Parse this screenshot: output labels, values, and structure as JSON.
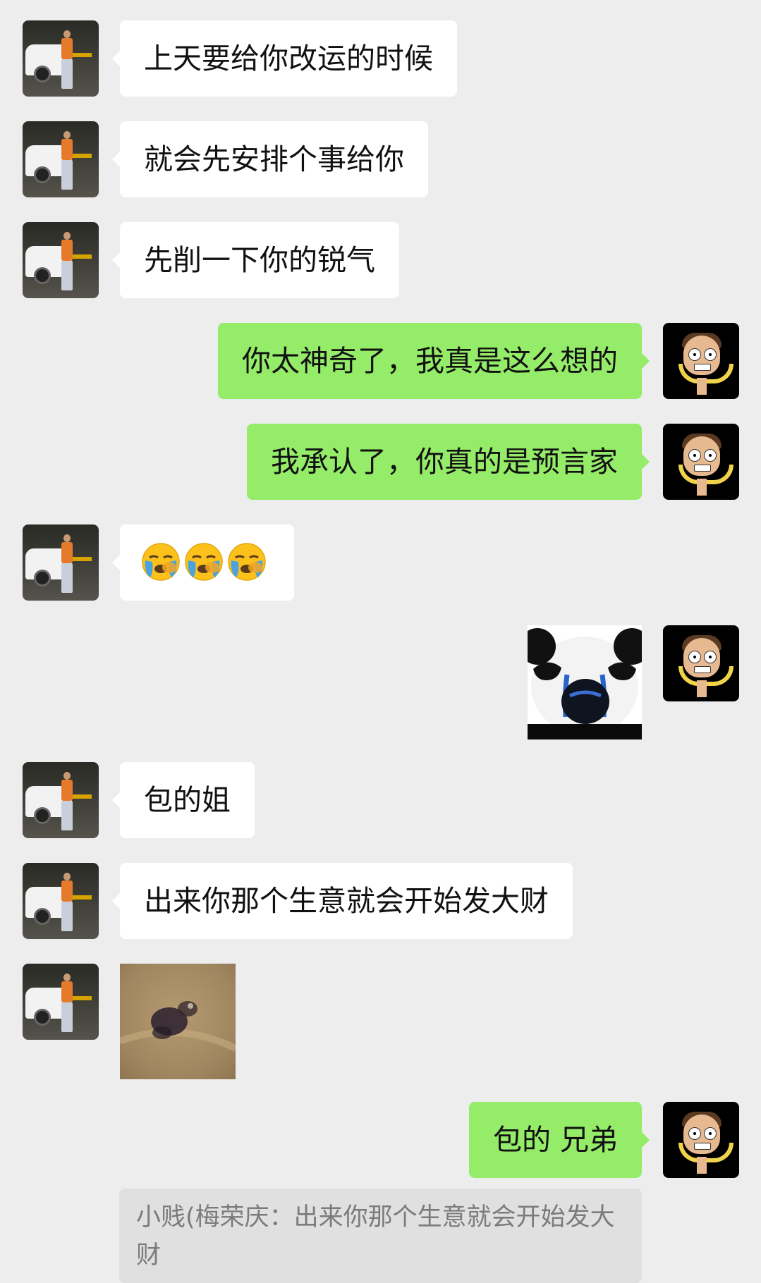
{
  "messages": [
    {
      "side": "left",
      "type": "text",
      "text": "上天要给你改运的时候"
    },
    {
      "side": "left",
      "type": "text",
      "text": "就会先安排个事给你"
    },
    {
      "side": "left",
      "type": "text",
      "text": "先削一下你的锐气"
    },
    {
      "side": "right",
      "type": "text",
      "text": "你太神奇了，我真是这么想的"
    },
    {
      "side": "right",
      "type": "text",
      "text": "我承认了，你真的是预言家"
    },
    {
      "side": "left",
      "type": "emoji",
      "emoji": [
        "loudly-crying-face-emoji",
        "loudly-crying-face-emoji",
        "loudly-crying-face-emoji"
      ]
    },
    {
      "side": "right",
      "type": "sticker",
      "sticker": "crying-panda-sticker"
    },
    {
      "side": "left",
      "type": "text",
      "text": "包的姐"
    },
    {
      "side": "left",
      "type": "text",
      "text": "出来你那个生意就会开始发大财"
    },
    {
      "side": "left",
      "type": "sticker",
      "sticker": "blurry-animal-sticker"
    },
    {
      "side": "right",
      "type": "text",
      "text": "包的 兄弟"
    }
  ],
  "quote": {
    "text": "小贱(梅荣庆：出来你那个生意就会开始发大财"
  },
  "colors": {
    "background": "#ededed",
    "incoming_bubble": "#ffffff",
    "outgoing_bubble": "#95ec69",
    "quote_background": "#e0e0e0",
    "quote_text": "#7b7b7b"
  }
}
